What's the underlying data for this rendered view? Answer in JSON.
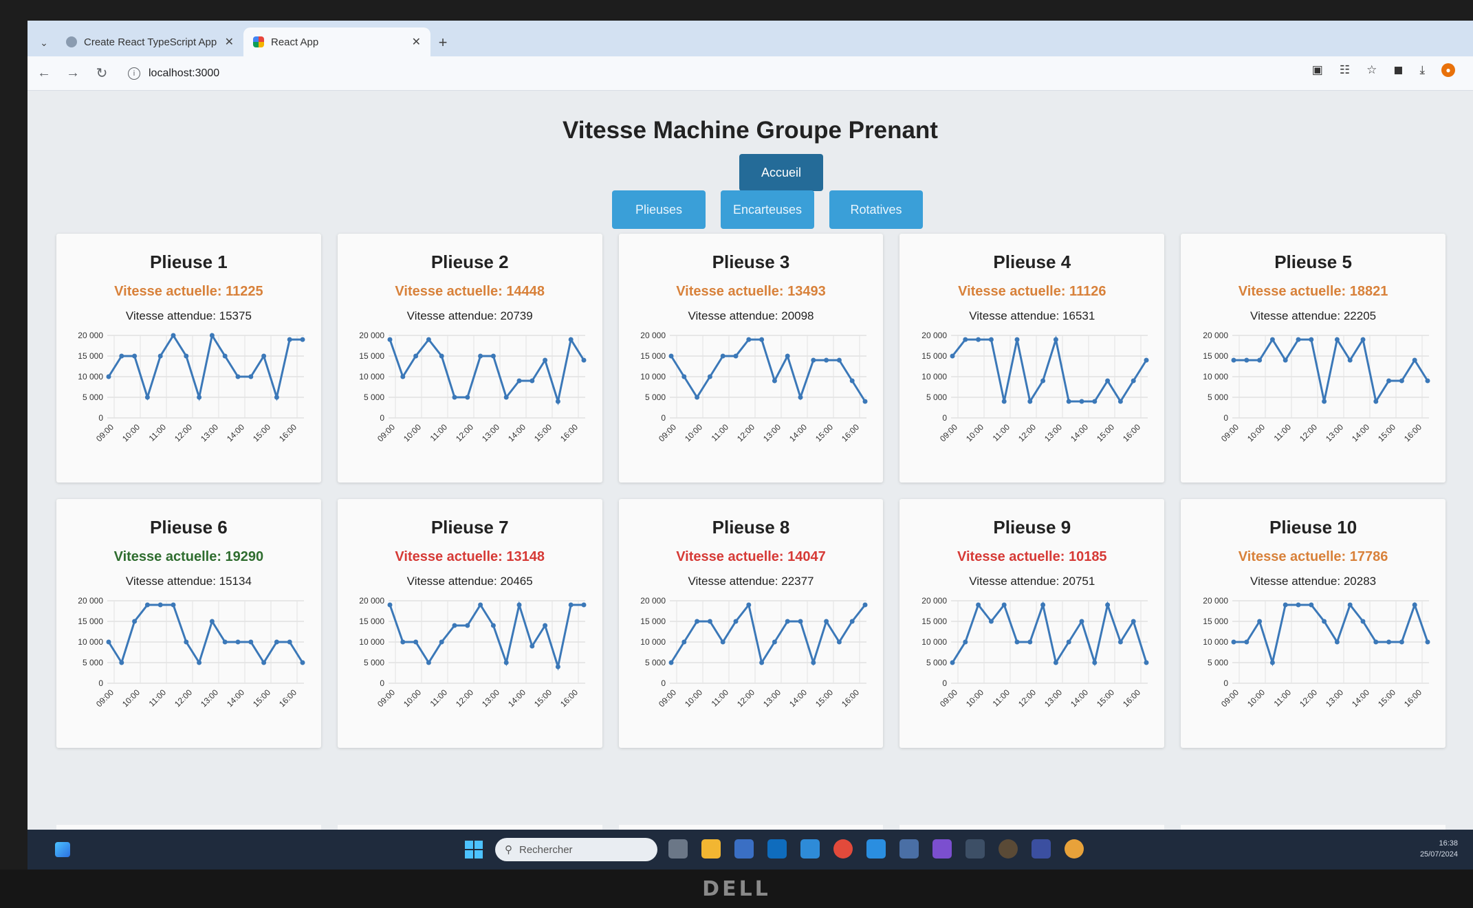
{
  "browser": {
    "tabs": [
      {
        "title": "Create React TypeScript App",
        "active": false
      },
      {
        "title": "React App",
        "active": true
      }
    ],
    "url": "localhost:3000"
  },
  "page": {
    "title": "Vitesse Machine Groupe Prenant",
    "home_label": "Accueil",
    "categories": [
      "Plieuses",
      "Encarteuses",
      "Rotatives"
    ]
  },
  "colors": {
    "orange": "#d8813a",
    "red": "#d63a36",
    "green": "#2f6d2f",
    "line": "#3b78b8",
    "home_button": "#246b98",
    "category_button": "#3a9fd8"
  },
  "chart_common": {
    "type": "line",
    "x_ticks": [
      "09:00",
      "10:00",
      "11:00",
      "12:00",
      "13:00",
      "14:00",
      "15:00",
      "16:00"
    ],
    "y_ticks": [
      "0",
      "5 000",
      "10 000",
      "15 000",
      "20 000"
    ],
    "ylim": [
      0,
      20000
    ]
  },
  "machines": [
    {
      "name": "Plieuse 1",
      "speed_label": "Vitesse actuelle: 11225",
      "speed_color": "orange",
      "expected_label": "Vitesse attendue: 15375",
      "chart_data": {
        "type": "line",
        "values": [
          10000,
          15000,
          15000,
          5000,
          15000,
          20000,
          15000,
          5000,
          20000,
          15000,
          10000,
          10000,
          15000,
          5000,
          19000,
          19000
        ]
      }
    },
    {
      "name": "Plieuse 2",
      "speed_label": "Vitesse actuelle: 14448",
      "speed_color": "orange",
      "expected_label": "Vitesse attendue: 20739",
      "chart_data": {
        "type": "line",
        "values": [
          19000,
          10000,
          15000,
          19000,
          15000,
          5000,
          5000,
          15000,
          15000,
          5000,
          9000,
          9000,
          14000,
          4000,
          19000,
          14000
        ]
      }
    },
    {
      "name": "Plieuse 3",
      "speed_label": "Vitesse actuelle: 13493",
      "speed_color": "orange",
      "expected_label": "Vitesse attendue: 20098",
      "chart_data": {
        "type": "line",
        "values": [
          15000,
          10000,
          5000,
          10000,
          15000,
          15000,
          19000,
          19000,
          9000,
          15000,
          5000,
          14000,
          14000,
          14000,
          9000,
          4000
        ]
      }
    },
    {
      "name": "Plieuse 4",
      "speed_label": "Vitesse actuelle: 11126",
      "speed_color": "orange",
      "expected_label": "Vitesse attendue: 16531",
      "chart_data": {
        "type": "line",
        "values": [
          15000,
          19000,
          19000,
          19000,
          4000,
          19000,
          4000,
          9000,
          19000,
          4000,
          4000,
          4000,
          9000,
          4000,
          9000,
          14000
        ]
      }
    },
    {
      "name": "Plieuse 5",
      "speed_label": "Vitesse actuelle: 18821",
      "speed_color": "orange",
      "expected_label": "Vitesse attendue: 22205",
      "chart_data": {
        "type": "line",
        "values": [
          14000,
          14000,
          14000,
          19000,
          14000,
          19000,
          19000,
          4000,
          19000,
          14000,
          19000,
          4000,
          9000,
          9000,
          14000,
          9000
        ]
      }
    },
    {
      "name": "Plieuse 6",
      "speed_label": "Vitesse actuelle: 19290",
      "speed_color": "green",
      "expected_label": "Vitesse attendue: 15134",
      "chart_data": {
        "type": "line",
        "values": [
          10000,
          5000,
          15000,
          19000,
          19000,
          19000,
          10000,
          5000,
          15000,
          10000,
          10000,
          10000,
          5000,
          10000,
          10000,
          5000
        ]
      }
    },
    {
      "name": "Plieuse 7",
      "speed_label": "Vitesse actuelle: 13148",
      "speed_color": "red",
      "expected_label": "Vitesse attendue: 20465",
      "chart_data": {
        "type": "line",
        "values": [
          19000,
          10000,
          10000,
          5000,
          10000,
          14000,
          14000,
          19000,
          14000,
          5000,
          19000,
          9000,
          14000,
          4000,
          19000,
          19000
        ]
      }
    },
    {
      "name": "Plieuse 8",
      "speed_label": "Vitesse actuelle: 14047",
      "speed_color": "red",
      "expected_label": "Vitesse attendue: 22377",
      "chart_data": {
        "type": "line",
        "values": [
          5000,
          10000,
          15000,
          15000,
          10000,
          15000,
          19000,
          5000,
          10000,
          15000,
          15000,
          5000,
          15000,
          10000,
          15000,
          19000
        ]
      }
    },
    {
      "name": "Plieuse 9",
      "speed_label": "Vitesse actuelle: 10185",
      "speed_color": "red",
      "expected_label": "Vitesse attendue: 20751",
      "chart_data": {
        "type": "line",
        "values": [
          5000,
          10000,
          19000,
          15000,
          19000,
          10000,
          10000,
          19000,
          5000,
          10000,
          15000,
          5000,
          19000,
          10000,
          15000,
          5000
        ]
      }
    },
    {
      "name": "Plieuse 10",
      "speed_label": "Vitesse actuelle: 17786",
      "speed_color": "orange",
      "expected_label": "Vitesse attendue: 20283",
      "chart_data": {
        "type": "line",
        "values": [
          10000,
          10000,
          15000,
          5000,
          19000,
          19000,
          19000,
          15000,
          10000,
          19000,
          15000,
          10000,
          10000,
          10000,
          19000,
          10000
        ]
      }
    }
  ],
  "taskbar": {
    "search_placeholder": "Rechercher",
    "time": "16:38",
    "date": "25/07/2024"
  },
  "monitor_brand": "DELL"
}
